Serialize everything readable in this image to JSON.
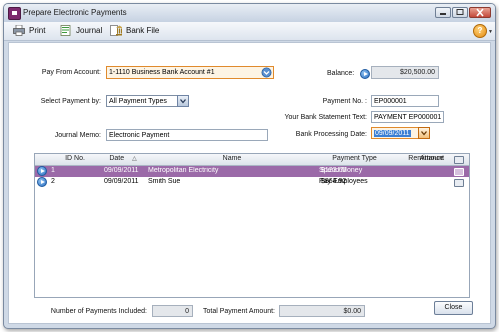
{
  "window": {
    "title": "Prepare Electronic Payments"
  },
  "toolbar": {
    "print": "Print",
    "journal": "Journal",
    "bank_file": "Bank File"
  },
  "form": {
    "pay_from_label": "Pay From Account:",
    "pay_from_value": "1-1110 Business Bank Account #1",
    "balance_label": "Balance:",
    "balance_value": "$20,500.00",
    "select_payment_label": "Select Payment by:",
    "select_payment_value": "All Payment Types",
    "payment_no_label": "Payment No. :",
    "payment_no_value": "EP000001",
    "statement_text_label": "Your Bank Statement Text:",
    "statement_text_value": "PAYMENT EP000001",
    "journal_memo_label": "Journal Memo:",
    "journal_memo_value": "Electronic Payment",
    "processing_date_label": "Bank Processing Date:",
    "processing_date_value": "09/09/2011"
  },
  "table": {
    "headers": [
      "ID No.",
      "Date",
      "Name",
      "Payment Type",
      "Amount",
      "Remittance"
    ],
    "sort_indicator": "△",
    "rows": [
      {
        "id": "1",
        "date": "09/09/2011",
        "name": "Metropolitan Electricity",
        "type": "Spend Money",
        "amount": "$123.65",
        "selected": true
      },
      {
        "id": "2",
        "date": "09/09/2011",
        "name": "Smith Sue",
        "type": "Pay Employees",
        "amount": "$864.92",
        "selected": false
      }
    ]
  },
  "summary": {
    "num_label": "Number of Payments Included:",
    "num_value": "0",
    "total_label": "Total Payment Amount:",
    "total_value": "$0.00"
  },
  "footer": {
    "close": "Close"
  },
  "colors": {
    "selected_row": "#9b6aa8",
    "accent_orange": "#e08a2c",
    "arrow_blue": "#2b6fc2"
  }
}
